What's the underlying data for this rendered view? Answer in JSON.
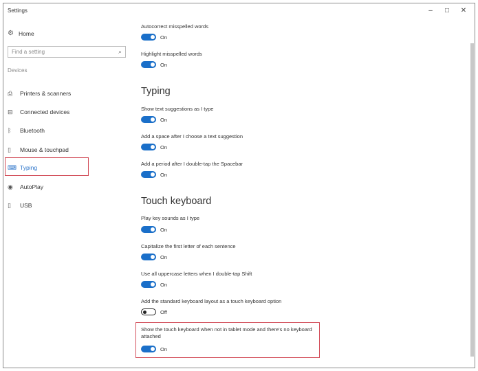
{
  "window": {
    "title": "Settings",
    "minimize": "–",
    "maximize": "□",
    "close": "✕"
  },
  "sidebar": {
    "home": "Home",
    "search_placeholder": "Find a setting",
    "section": "Devices",
    "items": [
      {
        "label": "Printers & scanners",
        "icon": "printer-icon",
        "glyph": "⎙"
      },
      {
        "label": "Connected devices",
        "icon": "connected-devices-icon",
        "glyph": "⊟"
      },
      {
        "label": "Bluetooth",
        "icon": "bluetooth-icon",
        "glyph": "ᛒ"
      },
      {
        "label": "Mouse & touchpad",
        "icon": "mouse-icon",
        "glyph": "▯"
      },
      {
        "label": "Typing",
        "icon": "keyboard-icon",
        "glyph": "⌨",
        "selected": true
      },
      {
        "label": "AutoPlay",
        "icon": "autoplay-icon",
        "glyph": "◉"
      },
      {
        "label": "USB",
        "icon": "usb-icon",
        "glyph": "▯"
      }
    ]
  },
  "main": {
    "spelling": [
      {
        "label": "Autocorrect misspelled words",
        "state": "On"
      },
      {
        "label": "Highlight misspelled words",
        "state": "On"
      }
    ],
    "typing_header": "Typing",
    "typing": [
      {
        "label": "Show text suggestions as I type",
        "state": "On"
      },
      {
        "label": "Add a space after I choose a text suggestion",
        "state": "On"
      },
      {
        "label": "Add a period after I double-tap the Spacebar",
        "state": "On"
      }
    ],
    "touch_header": "Touch keyboard",
    "touch": [
      {
        "label": "Play key sounds as I type",
        "state": "On"
      },
      {
        "label": "Capitalize the first letter of each sentence",
        "state": "On"
      },
      {
        "label": "Use all uppercase letters when I double-tap Shift",
        "state": "On"
      },
      {
        "label": "Add the standard keyboard layout as a touch keyboard option",
        "state": "Off"
      },
      {
        "label": "Show the touch keyboard when not in tablet mode and there's no keyboard attached",
        "state": "On"
      }
    ]
  },
  "colors": {
    "accent": "#1a6fc9",
    "highlight_box": "#d24b57"
  }
}
